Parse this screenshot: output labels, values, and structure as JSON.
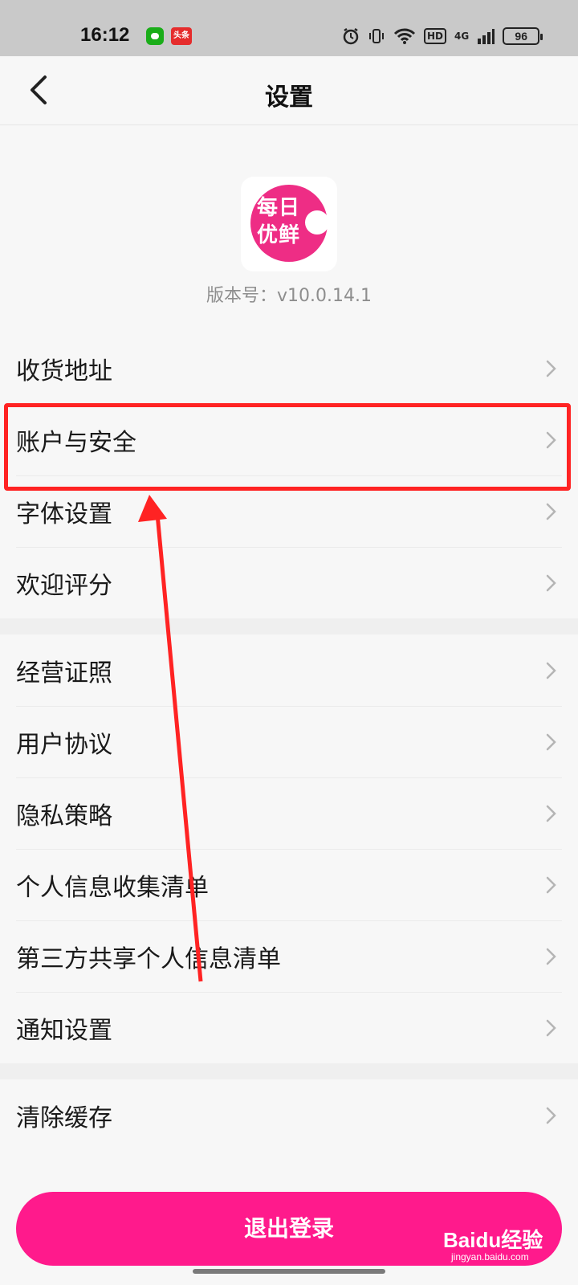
{
  "status_bar": {
    "time": "16:12",
    "app_badge": "头条",
    "network": "4G",
    "hd": "HD",
    "battery": "96"
  },
  "nav": {
    "title": "设置"
  },
  "app": {
    "logo_text": "每日优鲜",
    "version": "版本号：v10.0.14.1",
    "brand_color": "#ee2d85"
  },
  "section1": {
    "items": [
      "收货地址",
      "账户与安全",
      "字体设置",
      "欢迎评分"
    ]
  },
  "section2": {
    "items": [
      "经营证照",
      "用户协议",
      "隐私策略",
      "个人信息收集清单",
      "第三方共享个人信息清单",
      "通知设置"
    ]
  },
  "section3": {
    "items": [
      "清除缓存"
    ]
  },
  "logout": {
    "label": "退出登录",
    "color": "#ff1a8c"
  },
  "annotation": {
    "color": "#ff2323"
  },
  "watermark": {
    "text": "Baidu经验",
    "sub": "jingyan.baidu.com"
  }
}
